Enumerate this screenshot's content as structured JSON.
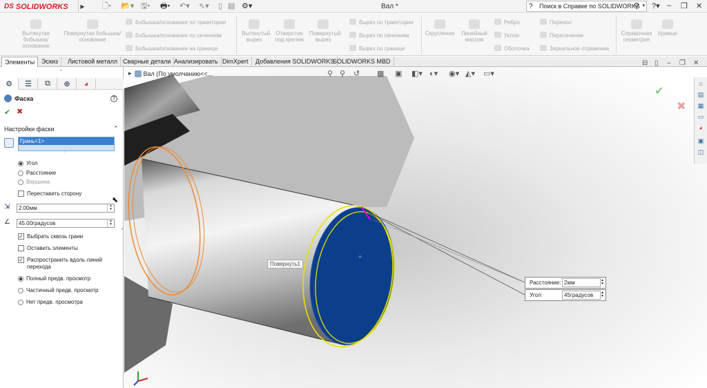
{
  "app": {
    "brand": "SOLIDWORKS",
    "brand_prefix": "DS",
    "document_title": "Вал *"
  },
  "search": {
    "placeholder": "Поиск в Справке по SOLIDWORKS"
  },
  "ribbon": {
    "big_buttons": [
      {
        "label": "Вытянутая бобышка/основание"
      },
      {
        "label": "Повернутая бобышка/основание"
      },
      {
        "label": "Вытянутый вырез"
      },
      {
        "label": "Отверстие под крепеж"
      },
      {
        "label": "Повернутый вырез"
      },
      {
        "label": "Скругление"
      },
      {
        "label": "Линейный массив"
      },
      {
        "label": "Справочная геометрия"
      },
      {
        "label": "Кривые"
      }
    ],
    "small_buttons": [
      {
        "label": "Бобышка/основание по траектории"
      },
      {
        "label": "Бобышка/основание по сечениям"
      },
      {
        "label": "Бобышка/основание на границе"
      },
      {
        "label": "Вырез по траектории"
      },
      {
        "label": "Вырез по сечениям"
      },
      {
        "label": "Вырез по границе"
      },
      {
        "label": "Ребро"
      },
      {
        "label": "Уклон"
      },
      {
        "label": "Оболочка"
      },
      {
        "label": "Перенос"
      },
      {
        "label": "Пересечение"
      },
      {
        "label": "Зеркальное отражение"
      }
    ]
  },
  "tabs": [
    "Элементы",
    "Эскиз",
    "Листовой металл",
    "Сварные детали",
    "Анализировать",
    "DimXpert",
    "Добавления SOLIDWORKS",
    "SOLIDWORKS MBD"
  ],
  "active_tab": "Элементы",
  "property_manager": {
    "title": "Фаска",
    "section_title": "Настройки фаски",
    "selection_item": "Грань<1>",
    "type_options": [
      {
        "label": "Угол",
        "selected": true,
        "enabled": true
      },
      {
        "label": "Расстояние",
        "selected": false,
        "enabled": true
      },
      {
        "label": "Вершина",
        "selected": false,
        "enabled": false
      }
    ],
    "flip_side": {
      "label": "Переставить сторону",
      "checked": false
    },
    "distance_value": "2.00мм",
    "angle_value": "45.00градусов",
    "options": [
      {
        "label": "Выбрать сквозь грани",
        "checked": true
      },
      {
        "label": "Оставить элементы",
        "checked": false
      },
      {
        "label": "Распространить вдоль линий перехода",
        "checked": true
      }
    ],
    "preview_options": [
      {
        "label": "Полный предв. просмотр",
        "selected": true
      },
      {
        "label": "Частичный предв. просмотр",
        "selected": false
      },
      {
        "label": "Нет предв. просмотра",
        "selected": false
      }
    ]
  },
  "viewport": {
    "breadcrumb": "Вал  (По умолчанию<<...",
    "tooltip": "Повернуть1",
    "callout": [
      {
        "label": "Расстояние:",
        "value": "2мм"
      },
      {
        "label": "Угол:",
        "value": "45градусов"
      }
    ]
  },
  "colors": {
    "selected_face": "#0b3f8c",
    "edge_highlight": "#e8e000",
    "sketch_orange": "#f08a2c",
    "accent": "#d4202a"
  }
}
